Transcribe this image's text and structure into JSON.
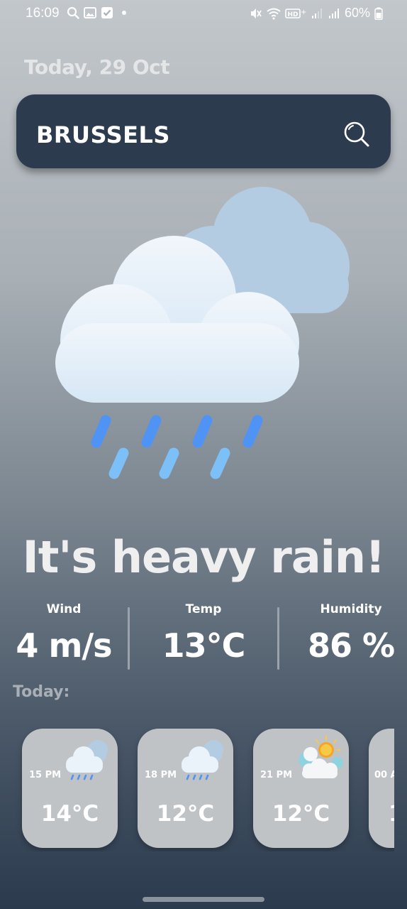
{
  "status_bar": {
    "time": "16:09",
    "battery": "60%",
    "icons_left": [
      "search-icon",
      "gallery-icon",
      "check-icon",
      "dot-icon"
    ],
    "icons_right": [
      "mute-icon",
      "wifi-icon",
      "hd-icon",
      "signal-icon",
      "signal-icon",
      "battery-icon"
    ]
  },
  "date": "Today, 29 Oct",
  "search": {
    "city": "BRUSSELS"
  },
  "illustration": "rain-cloud-icon",
  "headline": "It's heavy rain!",
  "stats": {
    "wind": {
      "label": "Wind",
      "value": "4 m/s"
    },
    "temp": {
      "label": "Temp",
      "value": "13°C"
    },
    "humidity": {
      "label": "Humidity",
      "value": "86 %"
    }
  },
  "today_label": "Today:",
  "forecast": [
    {
      "time": "15 PM",
      "temp": "14°C",
      "icon": "rain-cloud-icon"
    },
    {
      "time": "18 PM",
      "temp": "12°C",
      "icon": "rain-cloud-icon"
    },
    {
      "time": "21 PM",
      "temp": "12°C",
      "icon": "sun-cloud-icon"
    },
    {
      "time": "00 A",
      "temp": "1",
      "icon": "partial"
    }
  ],
  "colors": {
    "search_bar_bg": "#2c3b4e",
    "card_bg": "#c0c3c6",
    "rain_blue": "#4f93f5",
    "rain_light": "#7dbff7"
  }
}
